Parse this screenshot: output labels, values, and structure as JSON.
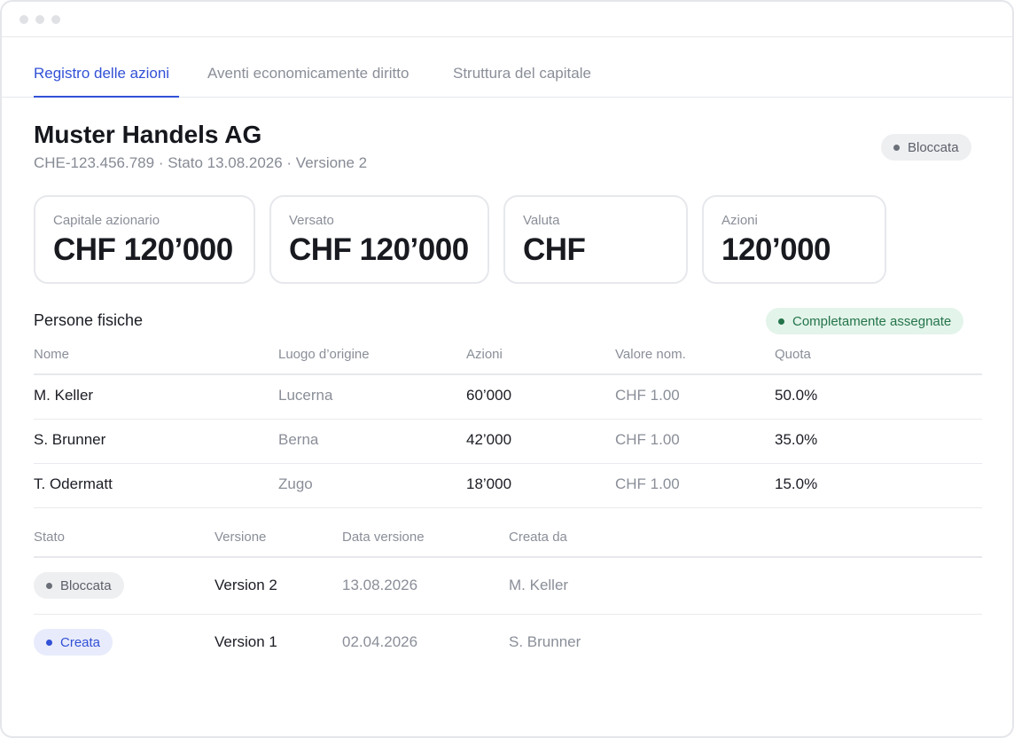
{
  "tabs": [
    {
      "label": "Registro delle azioni",
      "active": true
    },
    {
      "label": "Aventi economicamente diritto",
      "active": false
    },
    {
      "label": "Struttura del capitale",
      "active": false
    }
  ],
  "company": {
    "name": "Muster Handels AG",
    "meta": "CHE-123.456.789 · Stato 13.08.2026 · Versione 2",
    "status": "Bloccata"
  },
  "cards": [
    {
      "label": "Capitale azionario",
      "value": "CHF 120’000"
    },
    {
      "label": "Versato",
      "value": "CHF 120’000"
    },
    {
      "label": "Valuta",
      "value": "CHF"
    },
    {
      "label": "Azioni",
      "value": "120’000"
    }
  ],
  "persons": {
    "title": "Persone fisiche",
    "badge": "Completamente assegnate",
    "headers": [
      "Nome",
      "Luogo d’origine",
      "Azioni",
      "Valore nom.",
      "Quota"
    ],
    "rows": [
      {
        "name": "M. Keller",
        "origin": "Lucerna",
        "shares": "60’000",
        "nominal": "CHF 1.00",
        "quota": "50.0%"
      },
      {
        "name": "S. Brunner",
        "origin": "Berna",
        "shares": "42’000",
        "nominal": "CHF 1.00",
        "quota": "35.0%"
      },
      {
        "name": "T. Odermatt",
        "origin": "Zugo",
        "shares": "18’000",
        "nominal": "CHF 1.00",
        "quota": "15.0%"
      }
    ]
  },
  "versions": {
    "headers": [
      "Stato",
      "Versione",
      "Data versione",
      "Creata da"
    ],
    "rows": [
      {
        "status": "Bloccata",
        "status_color": "#6b6f78",
        "version": "Version 2",
        "date": "13.08.2026",
        "author": "M. Keller"
      },
      {
        "status": "Creata",
        "status_color": "#3251d6",
        "version": "Version 1",
        "date": "02.04.2026",
        "author": "S. Brunner"
      }
    ]
  },
  "colors": {
    "accent": "#3251d6",
    "success": "#23744a",
    "neutral": "#6b6f78"
  }
}
